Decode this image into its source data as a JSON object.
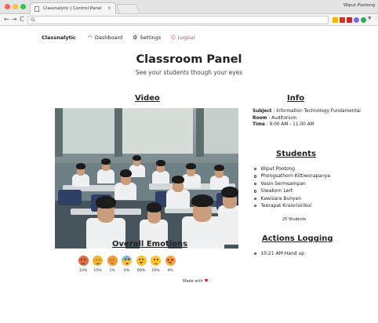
{
  "browser": {
    "tab_title": "Classnalytic | Control Panel",
    "tab_close": "×",
    "profile_name": "Wiput Pootong",
    "nav": {
      "back": "←",
      "forward": "→",
      "reload": "C"
    },
    "address_placeholder": ""
  },
  "app": {
    "brand": "Classnalytic",
    "nav": [
      {
        "label": "Dashboard",
        "icon": "gauge-icon"
      },
      {
        "label": "Settings",
        "icon": "gear-icon"
      },
      {
        "label": "Logout",
        "icon": "power-icon",
        "color": "#e0443a"
      }
    ]
  },
  "header": {
    "title": "Classroom Panel",
    "subtitle": "See your students though your eyes"
  },
  "video": {
    "heading": "Video"
  },
  "info": {
    "heading": "Info",
    "subject_label": "Subject",
    "subject_value": "Information Technology Fundamental",
    "room_label": "Room",
    "room_value": "Auditorium",
    "time_label": "Time",
    "time_value": "9:00 AM - 11:00 AM"
  },
  "students": {
    "heading": "Students",
    "list": [
      "Wiput Pootong",
      "Phongsathorn Kittiworapanya",
      "Vasin Sermsampan",
      "Siwakorn Lert",
      "Kawisara Bunyen",
      "Teerapat Kraisrisirikul"
    ],
    "count_label": "25 Students"
  },
  "actions": {
    "heading": "Actions Logging",
    "log": [
      "10:21 AM Hand up"
    ]
  },
  "emotions": {
    "heading": "Overall Emotions",
    "items": [
      {
        "icon": "angry-face-icon",
        "percent": "10%",
        "color": "#e36a3c"
      },
      {
        "icon": "unamused-face-icon",
        "percent": "15%",
        "color": "#f2b233"
      },
      {
        "icon": "tired-face-icon",
        "percent": "1%",
        "color": "#f29a33"
      },
      {
        "icon": "fearful-face-icon",
        "percent": "0%",
        "color": "#7ab8c8"
      },
      {
        "icon": "grinning-face-icon",
        "percent": "60%",
        "color": "#f7c22e"
      },
      {
        "icon": "neutral-face-icon",
        "percent": "10%",
        "color": "#f7c22e"
      },
      {
        "icon": "star-struck-face-icon",
        "percent": "4%",
        "color": "#f0a53a"
      }
    ]
  },
  "footer": {
    "made_with": "Made with"
  },
  "colors": {
    "accent_red": "#e0443a",
    "heart": "#d81b3c"
  }
}
